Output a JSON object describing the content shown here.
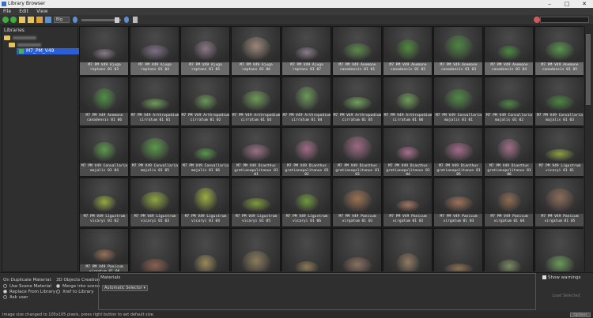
{
  "window": {
    "title": "Library Browser"
  },
  "menu": [
    "File",
    "Edit",
    "View"
  ],
  "toolbar": {
    "size_value": "Big"
  },
  "libraries": {
    "header": "Libraries",
    "selected_item": "M7_PM_V49"
  },
  "colors": {
    "selection": "#2b5fd9",
    "caption_bg": "#4c4c4c",
    "grid_bg": "#1c1c1c",
    "folder": "#e8c45c"
  },
  "items": [
    {
      "label": "M7 PM V49 Ajuga reptans 01 03",
      "color": "#8a7a8a"
    },
    {
      "label": "M7 PM V49 Ajuga reptans 01 04",
      "color": "#7e6f87"
    },
    {
      "label": "M7 PM V49 Ajuga reptans 01 05",
      "color": "#8c7785"
    },
    {
      "label": "M7 PM V49 Ajuga reptans 01 06",
      "color": "#9a8577"
    },
    {
      "label": "M7 PM V49 Ajuga reptans 01 07",
      "color": "#8a7a8a"
    },
    {
      "label": "M7 PM V49 Anemone canadensis 01 01",
      "color": "#5d8a4a"
    },
    {
      "label": "M7 PM V49 Anemone canadensis 01 02",
      "color": "#4f8a3c"
    },
    {
      "label": "M7 PM V49 Anemone canadensis 01 03",
      "color": "#4c8540"
    },
    {
      "label": "M7 PM V49 Anemone canadensis 01 04",
      "color": "#4a8840"
    },
    {
      "label": "M7 PM V49 Anemone canadensis 01 05",
      "color": "#56954a"
    },
    {
      "label": "M7 PM V49 Anemone canadensis 01 06",
      "color": "#4f8f45"
    },
    {
      "label": "M7 PM V49 Arthropodium cirratum 01 01",
      "color": "#6f9a58"
    },
    {
      "label": "M7 PM V49 Arthropodium cirratum 01 02",
      "color": "#6a9656"
    },
    {
      "label": "M7 PM V49 Arthropodium cirratum 01 03",
      "color": "#6c9a55"
    },
    {
      "label": "M7 PM V49 Arthropodium cirratum 01 04",
      "color": "#6a9856"
    },
    {
      "label": "M7 PM V49 Arthropodium cirratum 01 05",
      "color": "#71a05c"
    },
    {
      "label": "M7 PM V49 Arthropodium cirratum 01 06",
      "color": "#6e9c58"
    },
    {
      "label": "M7 PM V49 Convallaria majalis 01 01",
      "color": "#4f8a45"
    },
    {
      "label": "M7 PM V49 Convallaria majalis 01 02",
      "color": "#4c8742"
    },
    {
      "label": "M7 PM V49 Convallaria majalis 01 03",
      "color": "#4a8540"
    },
    {
      "label": "M7 PM V49 Convallaria majalis 01 04",
      "color": "#5c9a4c"
    },
    {
      "label": "M7 PM V49 Convallaria majalis 01 05",
      "color": "#5a984a"
    },
    {
      "label": "M7 PM V49 Convallaria majalis 01 06",
      "color": "#58964a"
    },
    {
      "label": "M7 PM V49 Dianthus gratianopolitanus 01 01",
      "color": "#9a6f85"
    },
    {
      "label": "M7 PM V49 Dianthus gratianopolitanus 01 02",
      "color": "#a06a88"
    },
    {
      "label": "M7 PM V49 Dianthus gratianopolitanus 01 03",
      "color": "#9b6883"
    },
    {
      "label": "M7 PM V49 Dianthus gratianopolitanus 01 04",
      "color": "#a66e8c"
    },
    {
      "label": "M7 PM V49 Dianthus gratianopolitanus 01 05",
      "color": "#a26a89"
    },
    {
      "label": "M7 PM V49 Dianthus gratianopolitanus 01 06",
      "color": "#9f6d87"
    },
    {
      "label": "M7 PM V49 Ligustrum vicaryi 01 01",
      "color": "#8aa040"
    },
    {
      "label": "M7 PM V49 Ligustrum vicaryi 01 02",
      "color": "#95a842"
    },
    {
      "label": "M7 PM V49 Ligustrum vicaryi 01 03",
      "color": "#8ea540"
    },
    {
      "label": "M7 PM V49 Ligustrum vicaryi 01 04",
      "color": "#9aac3e"
    },
    {
      "label": "M7 PM V49 Ligustrum vicaryi 01 05",
      "color": "#7f9a3a"
    },
    {
      "label": "M7 PM V49 Ligustrum vicaryi 01 06",
      "color": "#6f9a3a"
    },
    {
      "label": "M7 PM V49 Panicum virgatum 01 01",
      "color": "#9a7050"
    },
    {
      "label": "M7 PM V49 Panicum virgatum 01 02",
      "color": "#a07560"
    },
    {
      "label": "M7 PM V49 Panicum virgatum 01 03",
      "color": "#9c7258"
    },
    {
      "label": "M7 PM V49 Panicum virgatum 01 04",
      "color": "#8e6a50"
    },
    {
      "label": "M7 PM V49 Panicum virgatum 01 05",
      "color": "#8a6a58"
    },
    {
      "label": "M7 PM V49 Panicum virgatum 01 06",
      "color": "#967058"
    },
    {
      "label": "",
      "color": "#8a6050"
    },
    {
      "label": "",
      "color": "#9a8a5a"
    },
    {
      "label": "",
      "color": "#8a7a5a"
    },
    {
      "label": "",
      "color": "#8c7a56"
    },
    {
      "label": "",
      "color": "#8a7060"
    },
    {
      "label": "",
      "color": "#907a60"
    },
    {
      "label": "",
      "color": "#8c7050"
    },
    {
      "label": "",
      "color": "#7a8a60"
    },
    {
      "label": "",
      "color": "#6a9a5a"
    }
  ],
  "duplicate": {
    "title": "On Duplicate Material:",
    "options": [
      "Use Scene Material",
      "Replace From Library",
      "Ask user"
    ],
    "selected": 1
  },
  "creation": {
    "title": "3D Objects Creation",
    "options": [
      "Merge into scene",
      "Xref to Library"
    ],
    "selected": 0
  },
  "materials": {
    "title": "Materials",
    "selector": "Automatic Selector"
  },
  "right": {
    "show_warnings": "Show warnings",
    "load_selected": "Load Selected"
  },
  "status": {
    "text": "Image size changed to 105x105 pixels, press right button to set default size.",
    "options_label": "Options"
  }
}
